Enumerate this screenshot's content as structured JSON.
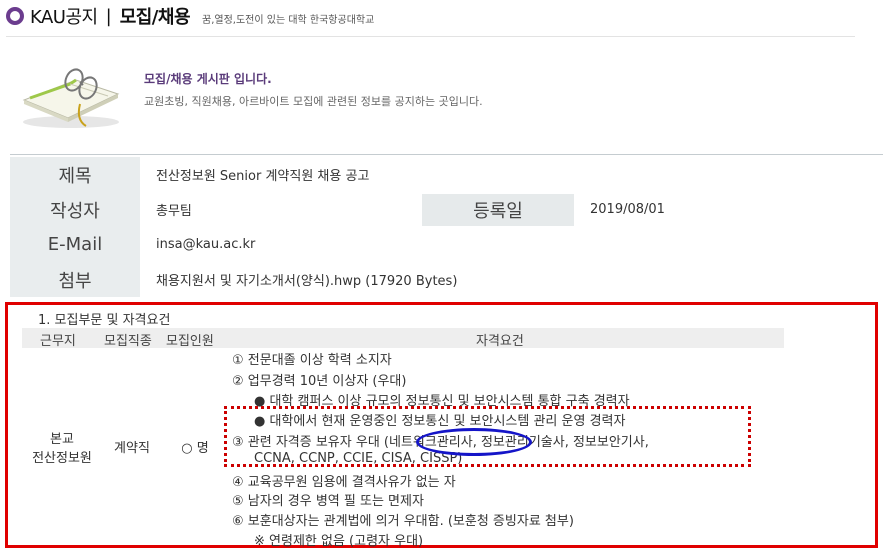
{
  "header": {
    "brand": "KAU공지",
    "separator": "|",
    "title": "모집/채용",
    "slogan": "꿈,열정,도전이 있는 대학 한국항공대학교"
  },
  "intro": {
    "title": "모집/채용 게시판 입니다.",
    "desc": "교원초빙, 직원채용, 아르바이트 모집에 관련된 정보를 공지하는 곳입니다."
  },
  "post": {
    "subject_label": "제목",
    "subject": "전산정보원 Senior 계약직원 채용 공고",
    "author_label": "작성자",
    "author": "총무팀",
    "date_label": "등록일",
    "date": "2019/08/01",
    "email_label": "E-Mail",
    "email": "insa@kau.ac.kr",
    "attach_label": "첨부",
    "attachment": "채용지원서 및 자기소개서(양식).hwp (17920 Bytes)"
  },
  "content": {
    "section_title": "1. 모집부문 및 자격요건",
    "headers": [
      "근무지",
      "모집직종",
      "모집인원",
      "자격요건"
    ],
    "workplace_line1": "본교",
    "workplace_line2": "전산정보원",
    "job_type": "계약직",
    "headcount": "○ 명",
    "requirements": [
      "① 전문대졸 이상 학력 소지자",
      "② 업무경력 10년 이상자 (우대)",
      "● 대학 캠퍼스 이상 규모의 정보통신 및 보안시스템 통합 구축 경력자",
      "● 대학에서 현재 운영중인 정보통신 및 보안시스템 관리 운영 경력자",
      "③ 관련 자격증 보유자 우대 (네트워크관리사, 정보관리기술사, 정보보안기사,",
      "CCNA, CCNP, CCIE, CISA, CISSP)",
      "④ 교육공무원 임용에 결격사유가 없는 자",
      "⑤ 남자의 경우 병역 필 또는 면제자",
      "⑥ 보훈대상자는 관계법에 의거 우대함. (보훈청 증빙자료 첨부)",
      "※ 연령제한 없음 (고령자 우대)"
    ]
  },
  "colors": {
    "brand_purple": "#6b3c8e",
    "label_bg": "#e9edee",
    "annotation_red": "#e00000",
    "annotation_blue": "#1515c8"
  },
  "icons": [
    "kau-logo-icon",
    "open-book-glasses-icon"
  ]
}
